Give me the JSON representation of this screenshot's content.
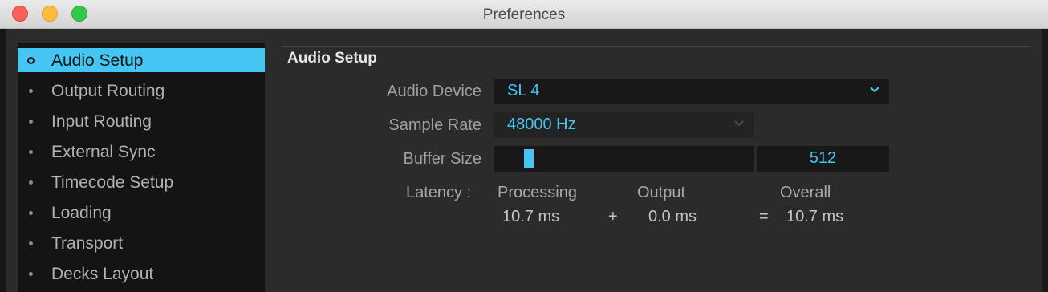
{
  "window": {
    "title": "Preferences"
  },
  "sidebar": {
    "items": [
      {
        "label": "Audio Setup",
        "active": true
      },
      {
        "label": "Output Routing",
        "active": false
      },
      {
        "label": "Input Routing",
        "active": false
      },
      {
        "label": "External Sync",
        "active": false
      },
      {
        "label": "Timecode Setup",
        "active": false
      },
      {
        "label": "Loading",
        "active": false
      },
      {
        "label": "Transport",
        "active": false
      },
      {
        "label": "Decks Layout",
        "active": false
      }
    ]
  },
  "main": {
    "section_title": "Audio Setup",
    "audio_device": {
      "label": "Audio Device",
      "value": "SL 4"
    },
    "sample_rate": {
      "label": "Sample Rate",
      "value": "48000 Hz"
    },
    "buffer_size": {
      "label": "Buffer Size",
      "value": "512",
      "slider_fraction": 0.12
    },
    "latency": {
      "label": "Latency :",
      "processing_header": "Processing",
      "output_header": "Output",
      "overall_header": "Overall",
      "processing_value": "10.7 ms",
      "plus": "+",
      "output_value": "0.0 ms",
      "equals": "=",
      "overall_value": "10.7 ms"
    }
  },
  "colors": {
    "accent": "#45c6f2",
    "sidebar_bg": "#141414",
    "panel_bg": "#2b2b2b"
  },
  "icons": {
    "close": "close-icon",
    "minimize": "minimize-icon",
    "maximize": "maximize-icon",
    "dropdown": "chevron-down-icon"
  }
}
